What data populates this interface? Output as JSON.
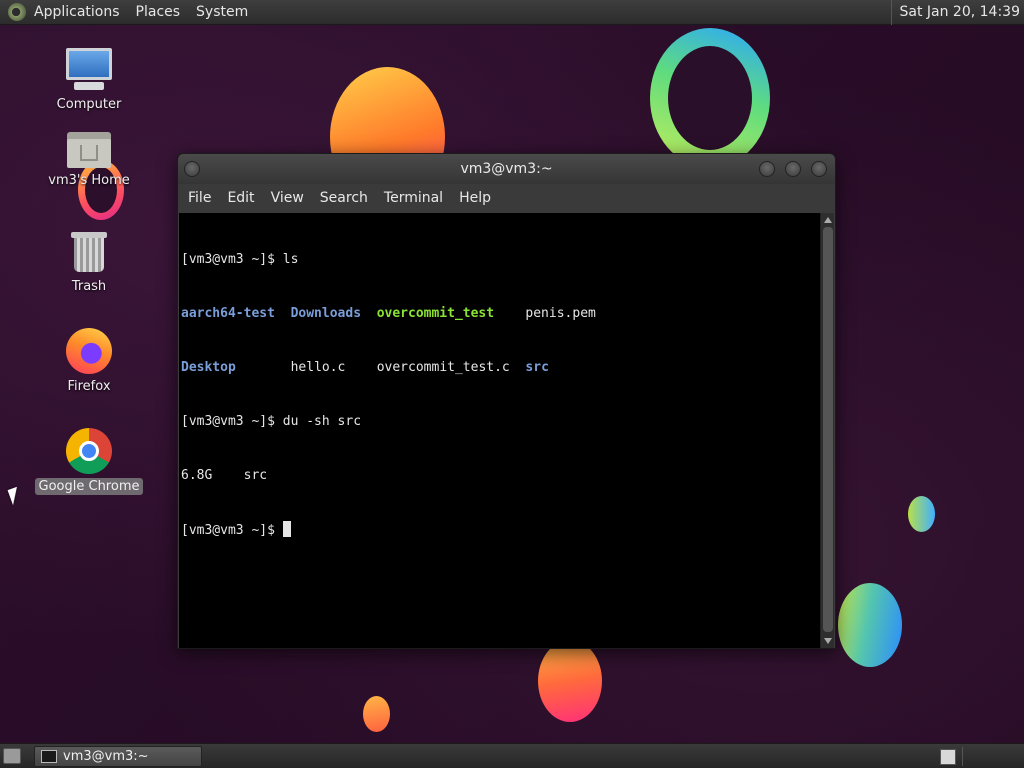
{
  "top_panel": {
    "menus": [
      "Applications",
      "Places",
      "System"
    ],
    "clock": "Sat Jan 20, 14:39"
  },
  "desktop": {
    "icons": [
      {
        "label": "Computer",
        "icon": "computer-icon"
      },
      {
        "label": "vm3's Home",
        "icon": "home-folder-icon"
      },
      {
        "label": "Trash",
        "icon": "trash-icon"
      },
      {
        "label": "Firefox",
        "icon": "firefox-icon"
      },
      {
        "label": "Google Chrome",
        "icon": "chrome-icon",
        "selected": true
      }
    ]
  },
  "window": {
    "title": "vm3@vm3:~",
    "menu": [
      "File",
      "Edit",
      "View",
      "Search",
      "Terminal",
      "Help"
    ],
    "terminal": {
      "prompt": "[vm3@vm3 ~]$ ",
      "cmd1": "ls",
      "ls_row1": [
        "aarch64-test",
        "Downloads",
        "overcommit_test",
        "penis.pem"
      ],
      "ls_row2": [
        "Desktop",
        "hello.c",
        "overcommit_test.c",
        "src"
      ],
      "cmd2": "du -sh src",
      "du_output": "6.8G    src"
    }
  },
  "bottom_panel": {
    "task": "vm3@vm3:~"
  }
}
